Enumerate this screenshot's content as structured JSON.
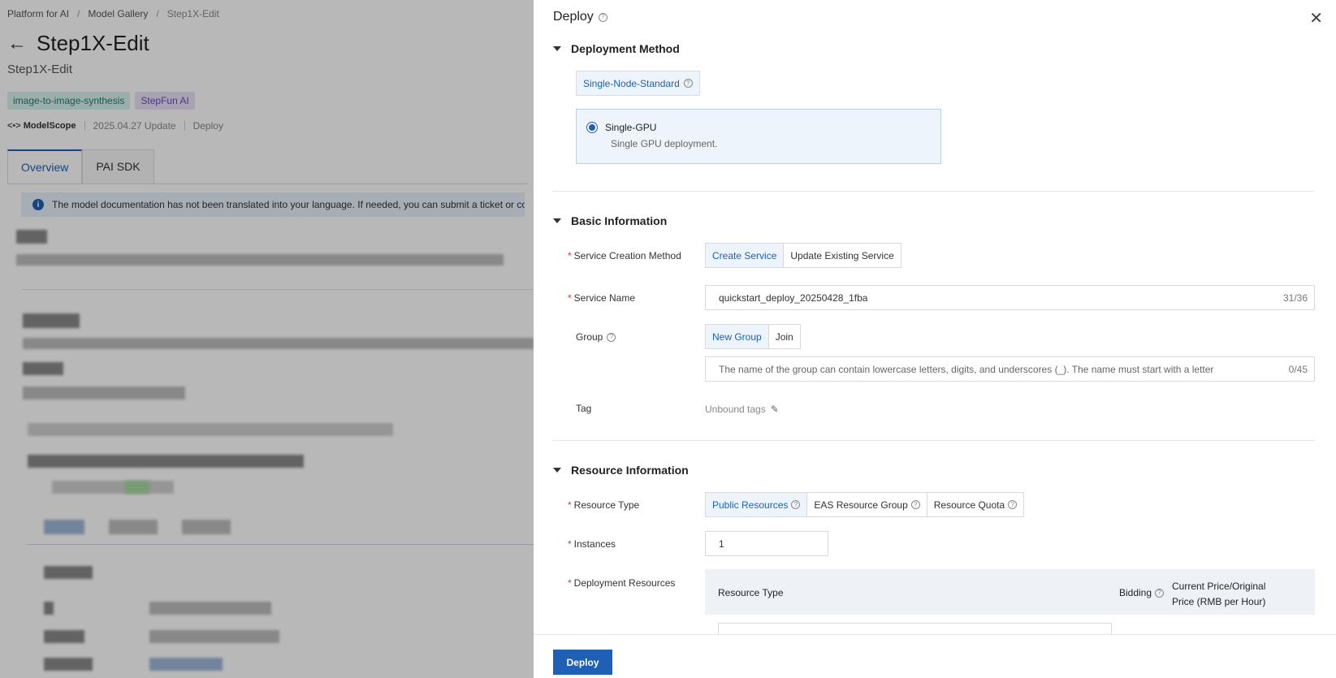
{
  "background": {
    "breadcrumb": [
      "Platform for AI",
      "Model Gallery",
      "Step1X-Edit"
    ],
    "title": "Step1X-Edit",
    "subtitle": "Step1X-Edit",
    "tags": [
      "image-to-image-synthesis",
      "StepFun AI"
    ],
    "meta": {
      "logo": "ModelScope",
      "updated": "2025.04.27 Update",
      "deploy": "Deploy"
    },
    "tabs": [
      "Overview",
      "PAI SDK"
    ],
    "notice": "The model documentation has not been translated into your language. If needed, you can submit a ticket or cor"
  },
  "drawer": {
    "title": "Deploy",
    "sections": {
      "deployment_method": "Deployment Method",
      "basic_information": "Basic Information",
      "resource_information": "Resource Information"
    },
    "deployment_method": {
      "chip": "Single-Node-Standard",
      "option_label": "Single-GPU",
      "option_desc": "Single GPU deployment."
    },
    "basic": {
      "service_creation_label": "Service Creation Method",
      "service_creation_options": [
        "Create Service",
        "Update Existing Service"
      ],
      "service_name_label": "Service Name",
      "service_name_value": "quickstart_deploy_20250428_1fba",
      "service_name_count": "31/36",
      "group_label": "Group",
      "group_options": [
        "New Group",
        "Join"
      ],
      "group_placeholder": "The name of the group can contain lowercase letters, digits, and underscores (_). The name must start with a letter",
      "group_count": "0/45",
      "tag_label": "Tag",
      "tag_value": "Unbound tags"
    },
    "resource": {
      "resource_type_label": "Resource Type",
      "resource_type_options": [
        "Public Resources",
        "EAS Resource Group",
        "Resource Quota"
      ],
      "instances_label": "Instances",
      "instances_value": "1",
      "deployment_resources_label": "Deployment Resources",
      "table_headers": {
        "resource_type": "Resource Type",
        "bidding": "Bidding",
        "price": "Current Price/Original Price (RMB per Hour)"
      }
    },
    "footer": {
      "deploy_button": "Deploy"
    }
  }
}
